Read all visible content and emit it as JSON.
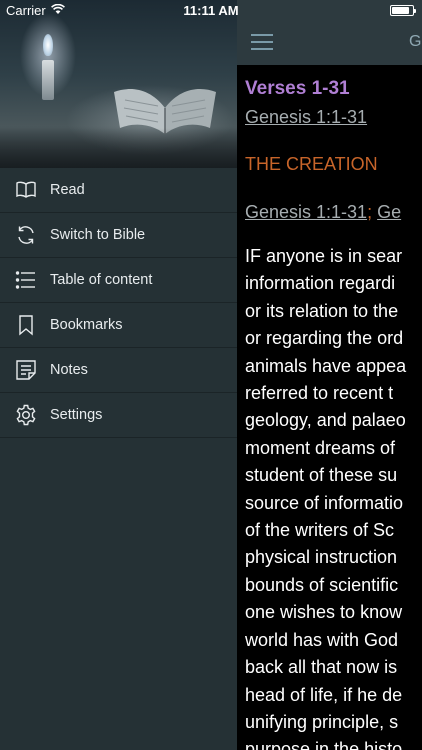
{
  "status": {
    "carrier": "Carrier",
    "time": "11:11 AM",
    "battery_level": 0.85
  },
  "drawer": {
    "menu": [
      {
        "label": "Read",
        "icon": "book-open-icon"
      },
      {
        "label": "Switch to Bible",
        "icon": "refresh-icon"
      },
      {
        "label": "Table of content",
        "icon": "list-icon"
      },
      {
        "label": "Bookmarks",
        "icon": "bookmark-icon"
      },
      {
        "label": "Notes",
        "icon": "notes-icon"
      },
      {
        "label": "Settings",
        "icon": "gear-icon"
      }
    ]
  },
  "nav": {
    "title": "G"
  },
  "reader": {
    "verses_title": "Verses 1-31",
    "ref_main": "Genesis 1:1-31",
    "section_title": "THE CREATION",
    "ref_line": {
      "ref1": "Genesis 1:1-31",
      "separator": ";",
      "ref2": "Ge"
    },
    "lines": [
      "IF anyone is in sear",
      "information regardi",
      "or its relation to the",
      "or regarding the ord",
      "animals have appea",
      "referred to recent t",
      "geology, and palaeo",
      "moment dreams of",
      "student of these su",
      "source of informatio",
      "of the writers of Sc",
      "physical instruction",
      "bounds of scientific",
      "one wishes to know",
      "world has with God",
      "back all that now is",
      "head of life, if he de",
      "unifying principle, s",
      "purpose in the histo"
    ]
  },
  "colors": {
    "accent_purple": "#b07fd4",
    "accent_orange": "#c8652a",
    "drawer_bg": "#253135",
    "navbar_bg": "#2d3a3f"
  }
}
